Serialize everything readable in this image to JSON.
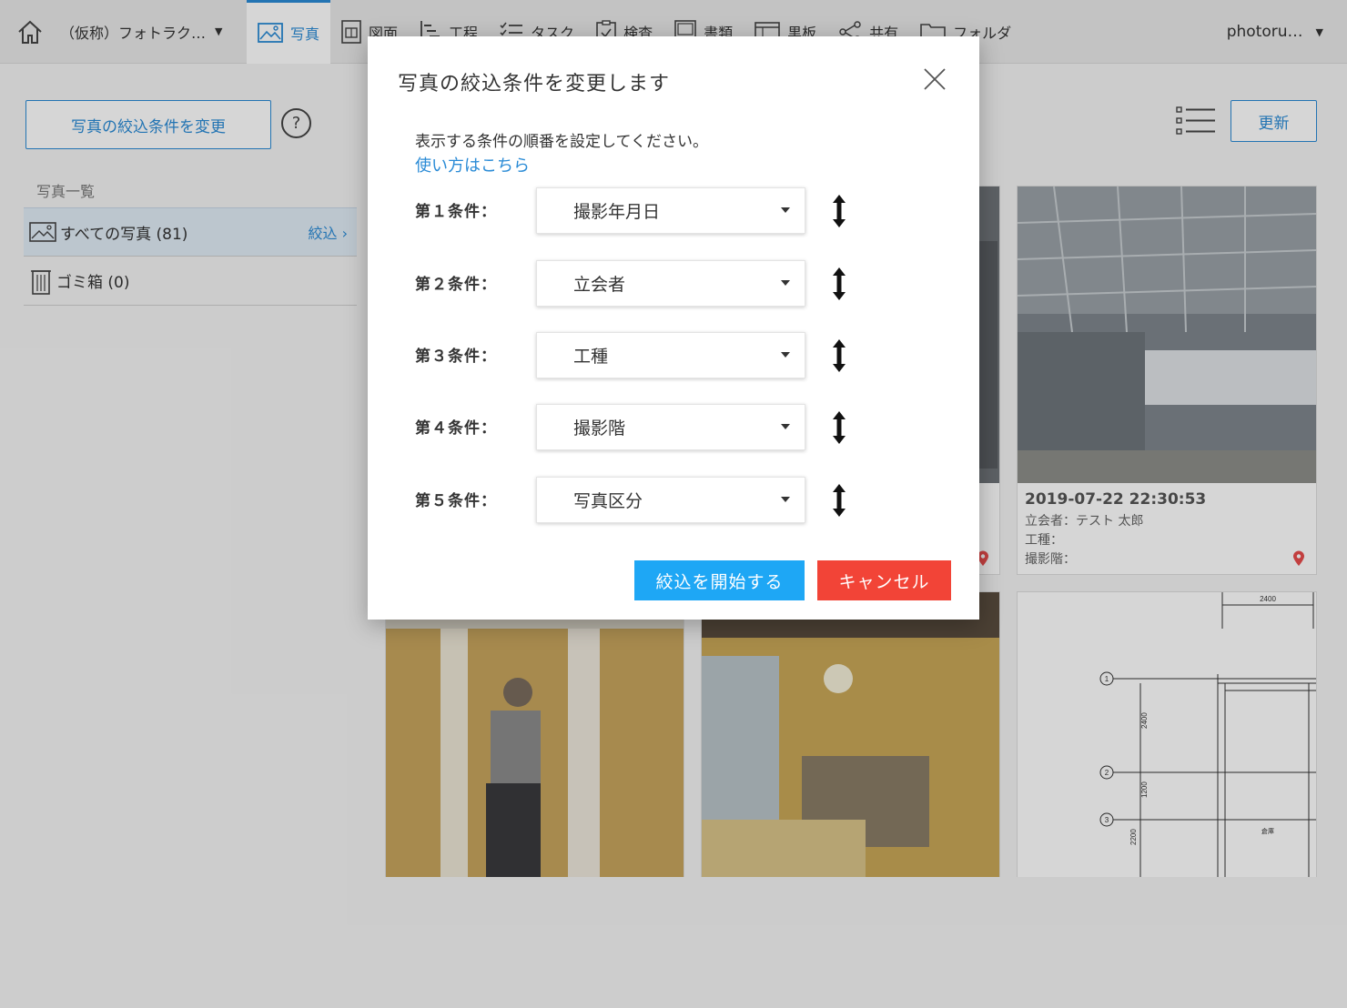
{
  "nav": {
    "project": "（仮称）フォトラク…",
    "items": [
      {
        "label": "写真",
        "icon": "photo-icon",
        "active": true
      },
      {
        "label": "図面",
        "icon": "drawing-icon"
      },
      {
        "label": "工程",
        "icon": "schedule-icon"
      },
      {
        "label": "タスク",
        "icon": "task-icon"
      },
      {
        "label": "検査",
        "icon": "inspection-icon"
      },
      {
        "label": "書類",
        "icon": "document-icon"
      },
      {
        "label": "黒板",
        "icon": "blackboard-icon"
      },
      {
        "label": "共有",
        "icon": "share-icon"
      },
      {
        "label": "フォルダ",
        "icon": "folder-icon"
      }
    ],
    "user": "photoru…",
    "accent": "#2a8bd6"
  },
  "sidebar": {
    "filter_button": "写真の絞込条件を変更",
    "help": "?",
    "section_label": "写真一覧",
    "items": [
      {
        "label": "すべての写真 (81)",
        "action": "絞込",
        "icon": "photo-icon"
      },
      {
        "label": "ゴミ箱 (0)",
        "icon": "trash-icon"
      }
    ]
  },
  "toolbar": {
    "refresh": "更新"
  },
  "photos": [
    {
      "date": "2019-07-22 22:30:53",
      "attendee": "立会者：テスト 太郎",
      "worktype": "工種：",
      "floor": "撮影階："
    }
  ],
  "drawing": {
    "dim_top": "2400",
    "dim_side_1": "2400",
    "dim_side_2": "1200",
    "dim_side_3": "2200",
    "grid_1": "1",
    "grid_2": "2",
    "grid_3": "3",
    "room": "倉庫"
  },
  "modal": {
    "title": "写真の絞込条件を変更します",
    "description": "表示する条件の順番を設定してください。",
    "howto_link": "使い方はこちら",
    "conditions": [
      {
        "label": "第１条件：",
        "value": "撮影年月日"
      },
      {
        "label": "第２条件：",
        "value": "立会者"
      },
      {
        "label": "第３条件：",
        "value": "工種"
      },
      {
        "label": "第４条件：",
        "value": "撮影階"
      },
      {
        "label": "第５条件：",
        "value": "写真区分"
      }
    ],
    "start_button": "絞込を開始する",
    "cancel_button": "キャンセル",
    "start_color": "#1ea7f5",
    "cancel_color": "#f24437"
  }
}
